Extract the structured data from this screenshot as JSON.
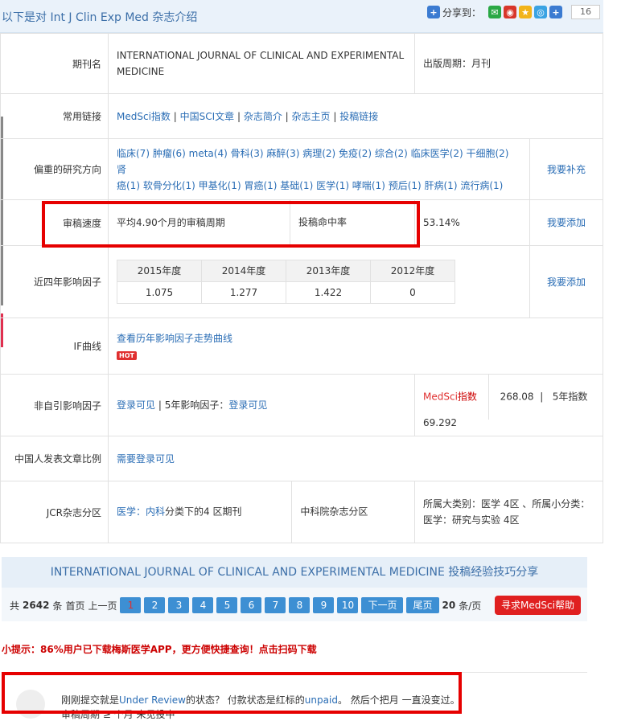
{
  "header": {
    "title": "以下是对 Int J Clin Exp Med 杂志介绍",
    "share_label": "分享到：",
    "share_count": "16"
  },
  "rows": {
    "journal_name": {
      "label": "期刊名",
      "value": "INTERNATIONAL JOURNAL OF CLINICAL AND EXPERIMENTAL MEDICINE",
      "freq_label": "出版周期：",
      "freq_value": "月刊"
    },
    "links": {
      "label": "常用链接",
      "items": [
        "MedSci指数",
        "中国SCI文章",
        "杂志简介",
        "杂志主页",
        "投稿链接"
      ]
    },
    "research": {
      "label": "偏重的研究方向",
      "line1": "临床(7) 肿瘤(6) meta(4) 骨科(3) 麻醉(3) 病理(2) 免疫(2) 综合(2) 临床医学(2) 干细胞(2) 肾",
      "line2": "癌(1) 软骨分化(1) 甲基化(1) 胃癌(1) 基础(1) 医学(1) 哮喘(1) 预后(1) 肝病(1) 流行病(1)",
      "action": "我要补充"
    },
    "review": {
      "label": "审稿速度",
      "value": "平均4.90个月的审稿周期",
      "hit_label": "投稿命中率",
      "hit_value": "53.14%",
      "action": "我要添加"
    },
    "if": {
      "label": "近四年影响因子",
      "years": [
        "2015年度",
        "2014年度",
        "2013年度",
        "2012年度"
      ],
      "values": [
        "1.075",
        "1.277",
        "1.422",
        "0"
      ],
      "action": "我要添加"
    },
    "curve": {
      "label": "IF曲线",
      "link": "查看历年影响因子走势曲线",
      "hot": "HOT"
    },
    "nonself": {
      "label": "非自引影响因子",
      "login1": "登录可见",
      "sep": " | 5年影响因子：",
      "login2": "登录可见",
      "medsci_a": "MedSci",
      "medsci_b": "指数",
      "score": "268.08",
      "score5": "5年指数69.292"
    },
    "chinese": {
      "label": "中国人发表文章比例",
      "value": "需要登录可见"
    },
    "jcr": {
      "label": "JCR杂志分区",
      "value_a": "医学：",
      "value_b": "内科",
      "value_c": "分类下的4 区期刊",
      "cas_label": "中科院杂志分区",
      "cas_line1": "所属大类别：医学 4区 、所属小分类：",
      "cas_line2": "医学：研究与实验 4区"
    }
  },
  "experience": {
    "title": "INTERNATIONAL JOURNAL OF CLINICAL AND EXPERIMENTAL MEDICINE 投稿经验技巧分享",
    "total_prefix": "共",
    "total": "2642",
    "total_suffix": "条",
    "first": "首页",
    "prev": "上一页",
    "pages": [
      "1",
      "2",
      "3",
      "4",
      "5",
      "6",
      "7",
      "8",
      "9",
      "10"
    ],
    "next": "下一页",
    "last": "尾页",
    "per_page": "20",
    "per_page_suffix": "条/页",
    "help": "寻求MedSci帮助"
  },
  "tip": "小提示：86%用户已下载梅斯医学APP，更方便快捷查询！点击扫码下载",
  "comment": {
    "text_a": "刚刚提交就是",
    "text_b": "Under Review",
    "text_c": "的状态？ 付款状态是红标的",
    "text_d": "unpaid",
    "text_e": "。 然后个把月 一直没变过。",
    "line2": "审稿周期 ≥ 个月 未见投中"
  },
  "colors": {
    "accent": "#3d8fd3",
    "highlight": "#e60000"
  }
}
